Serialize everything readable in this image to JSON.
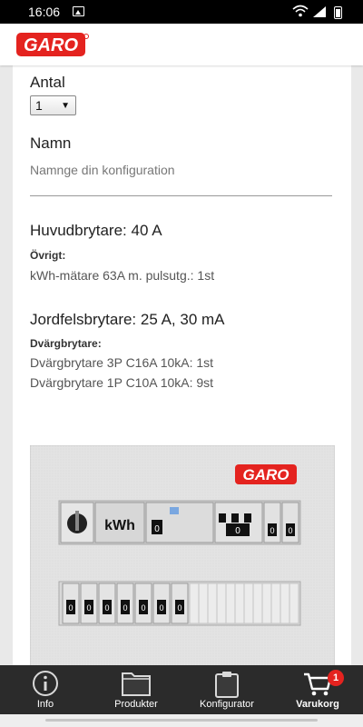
{
  "status_bar": {
    "time": "16:06"
  },
  "brand": {
    "logo_text": "GARO",
    "color": "#e4231f"
  },
  "form": {
    "quantity_label": "Antal",
    "quantity_value": "1",
    "name_label": "Namn",
    "name_placeholder": "Namnge din konfiguration"
  },
  "config": {
    "main_breaker_title": "Huvudbrytare: 40 A",
    "other_label": "Övrigt:",
    "other_items": [
      "kWh-mätare 63A m. pulsutg.: 1st"
    ],
    "rcd_title": "Jordfelsbrytare: 25 A, 30 mA",
    "mcb_label": "Dvärgbrytare:",
    "mcb_items": [
      "Dvärgbrytare 3P C16A 10kA: 1st",
      "Dvärgbrytare 1P C10A 10kA: 9st"
    ]
  },
  "panel": {
    "logo_text": "GARO",
    "meter_label": "kWh",
    "switch_label": "0",
    "rcd_switch_label": "0",
    "row2_switch_labels": [
      "0",
      "0",
      "0",
      "0",
      "0",
      "0",
      "0"
    ]
  },
  "bottom_nav": {
    "items": [
      {
        "label": "Info",
        "icon": "info-icon"
      },
      {
        "label": "Produkter",
        "icon": "folder-icon"
      },
      {
        "label": "Konfigurator",
        "icon": "clipboard-icon"
      },
      {
        "label": "Varukorg",
        "icon": "cart-icon"
      }
    ],
    "cart_count": "1",
    "active": "Varukorg"
  }
}
